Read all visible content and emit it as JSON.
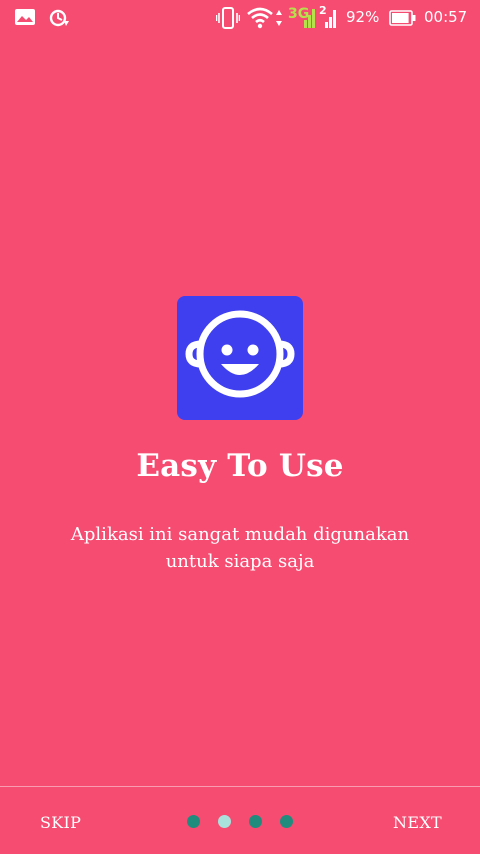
{
  "status_bar": {
    "left_icons": [
      "gallery-notification-icon",
      "sync-notification-icon"
    ],
    "right_icons": [
      "vibrate-icon",
      "wifi-icon",
      "data-transfer-icon",
      "sim1-signal-icon",
      "sim2-signal-icon",
      "battery-icon"
    ],
    "sim1_label": "3G",
    "sim2_label": "2",
    "battery_percent": "92%",
    "battery_level": 0.92,
    "time": "00:57"
  },
  "onboarding": {
    "icon": "smiley-face-icon",
    "title": "Easy To Use",
    "description_lines": [
      "Aplikasi ini sangat mudah digunakan",
      "untuk siapa saja"
    ]
  },
  "footer": {
    "skip_label": "SKIP",
    "next_label": "NEXT",
    "page_count": 4,
    "current_page": 2
  },
  "colors": {
    "background": "#F64C72",
    "icon_bg": "#3F3FF0",
    "dot_inactive": "#1F8C7E",
    "dot_active": "#A9E2DD",
    "text": "#FFFFFF",
    "network_accent": "#B7E14A"
  }
}
